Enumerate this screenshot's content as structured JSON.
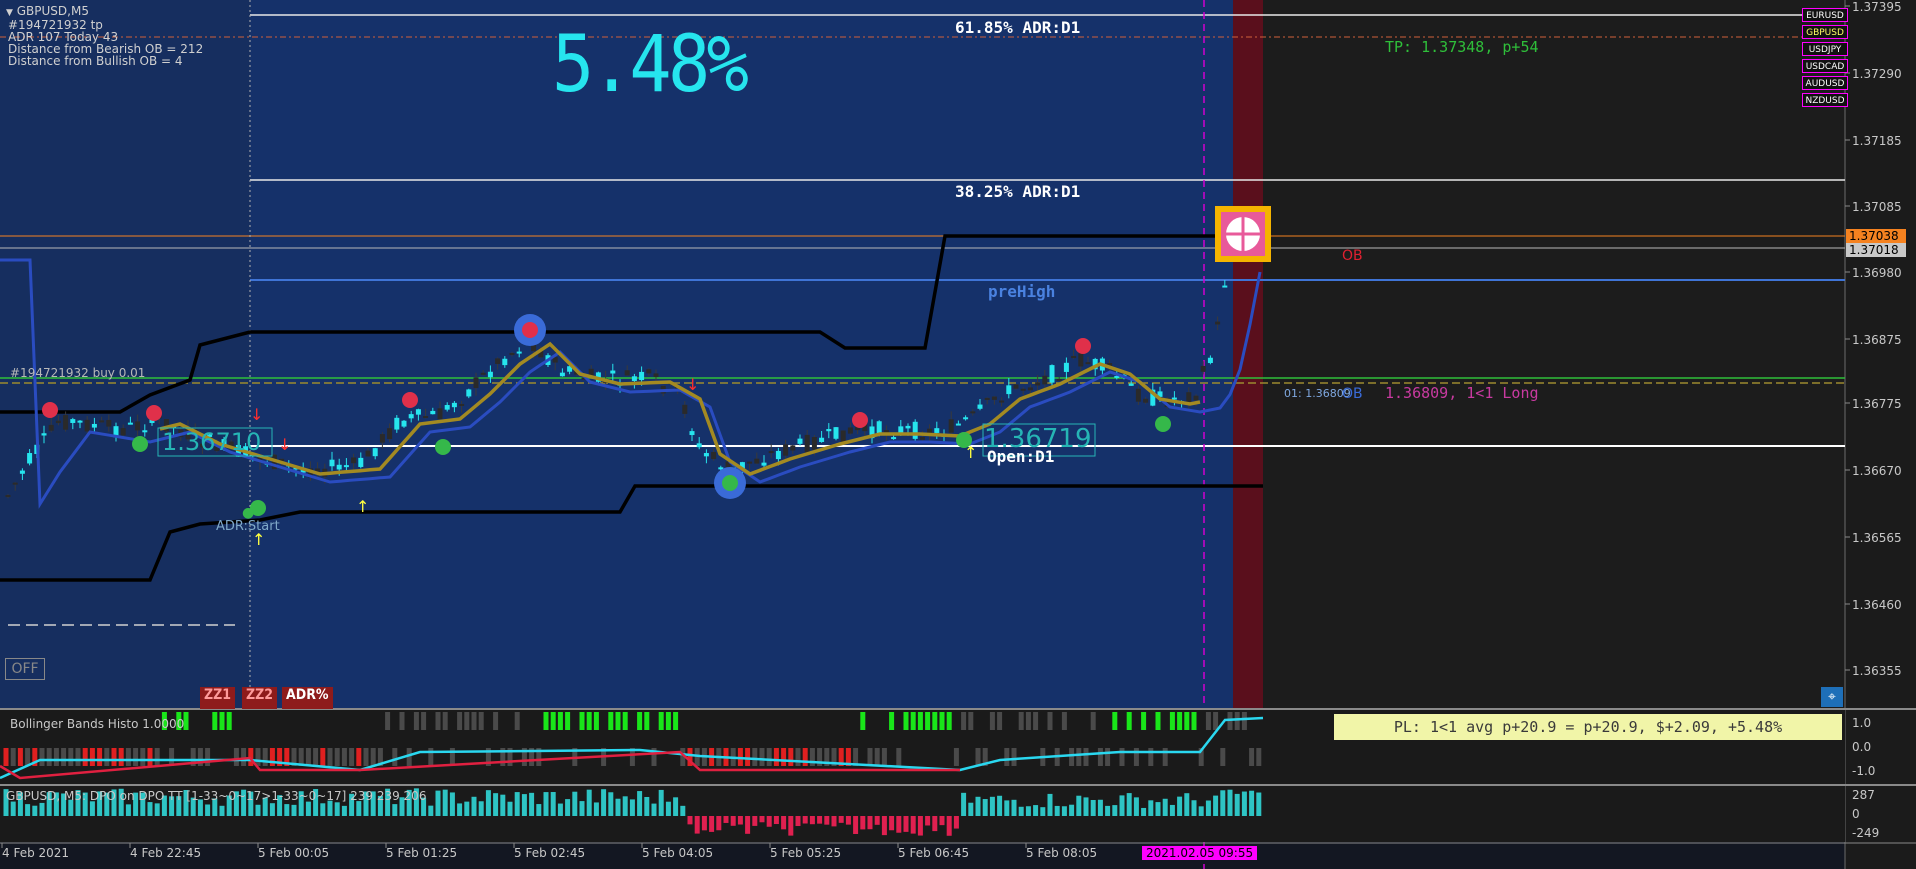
{
  "header": {
    "symbol_tf": "GBPUSD,M5",
    "order_tag": "#194721932 tp",
    "adr_line": "ADR 107  Today 43",
    "bearish_ob": "Distance from Bearish OB = 212",
    "bullish_ob": "Distance from Bullish OB = 4"
  },
  "big_percent": "5.48%",
  "levels": {
    "adr_618": "61.85% ADR:D1",
    "adr_382": "38.25% ADR:D1",
    "pre_high": "preHigh",
    "open_d1": "Open:D1",
    "adr_start": "ADR:Start",
    "ob_label": "OB",
    "ob_label2": "OB",
    "tp_text": "TP: 1.37348, p+54",
    "order_buy": "#194721932 buy 0.01",
    "long_text": "1.36809, 1<1 Long",
    "order_small": "01: 1.36809",
    "price_box_left": "1.36710",
    "price_box_right": "1.36719",
    "off_button": "OFF"
  },
  "buttons": {
    "zz1": "ZZ1",
    "zz2": "ZZ2",
    "adr": "ADR%"
  },
  "symbols": [
    "EURUSD",
    "GBPUSD",
    "USDJPY",
    "USDCAD",
    "AUDUSD",
    "NZDUSD"
  ],
  "active_symbol": "GBPUSD",
  "price_axis": [
    "1.37395",
    "1.37290",
    "1.37185",
    "1.37085",
    "1.36980",
    "1.36875",
    "1.36775",
    "1.36670",
    "1.36565",
    "1.36460",
    "1.36355"
  ],
  "price_tags": {
    "orange": "1.37038",
    "gray": "1.37018"
  },
  "indicator1": {
    "title": "Bollinger Bands Histo 1.0000",
    "pl_text": "PL: 1<1 avg p+20.9 = p+20.9, $+2.09, +5.48%",
    "axis": [
      "1.0",
      "0.0",
      "-1.0"
    ]
  },
  "indicator2": {
    "title": "GBPUSD, M5: DPO on DPO TT [1-33~0~17>1-33~0~17]  239 239 206",
    "axis": [
      "287",
      "0",
      "-249"
    ]
  },
  "time_axis": [
    "4 Feb 2021",
    "4 Feb 22:45",
    "5 Feb 00:05",
    "5 Feb 01:25",
    "5 Feb 02:45",
    "5 Feb 04:05",
    "5 Feb 05:25",
    "5 Feb 06:45",
    "5 Feb 08:05"
  ],
  "time_highlight": "2021.02.05 09:55",
  "colors": {
    "blue_panel": "#1a3368",
    "cyan": "#26e5ee",
    "orange": "#f58220",
    "magenta": "#ff00ff"
  }
}
